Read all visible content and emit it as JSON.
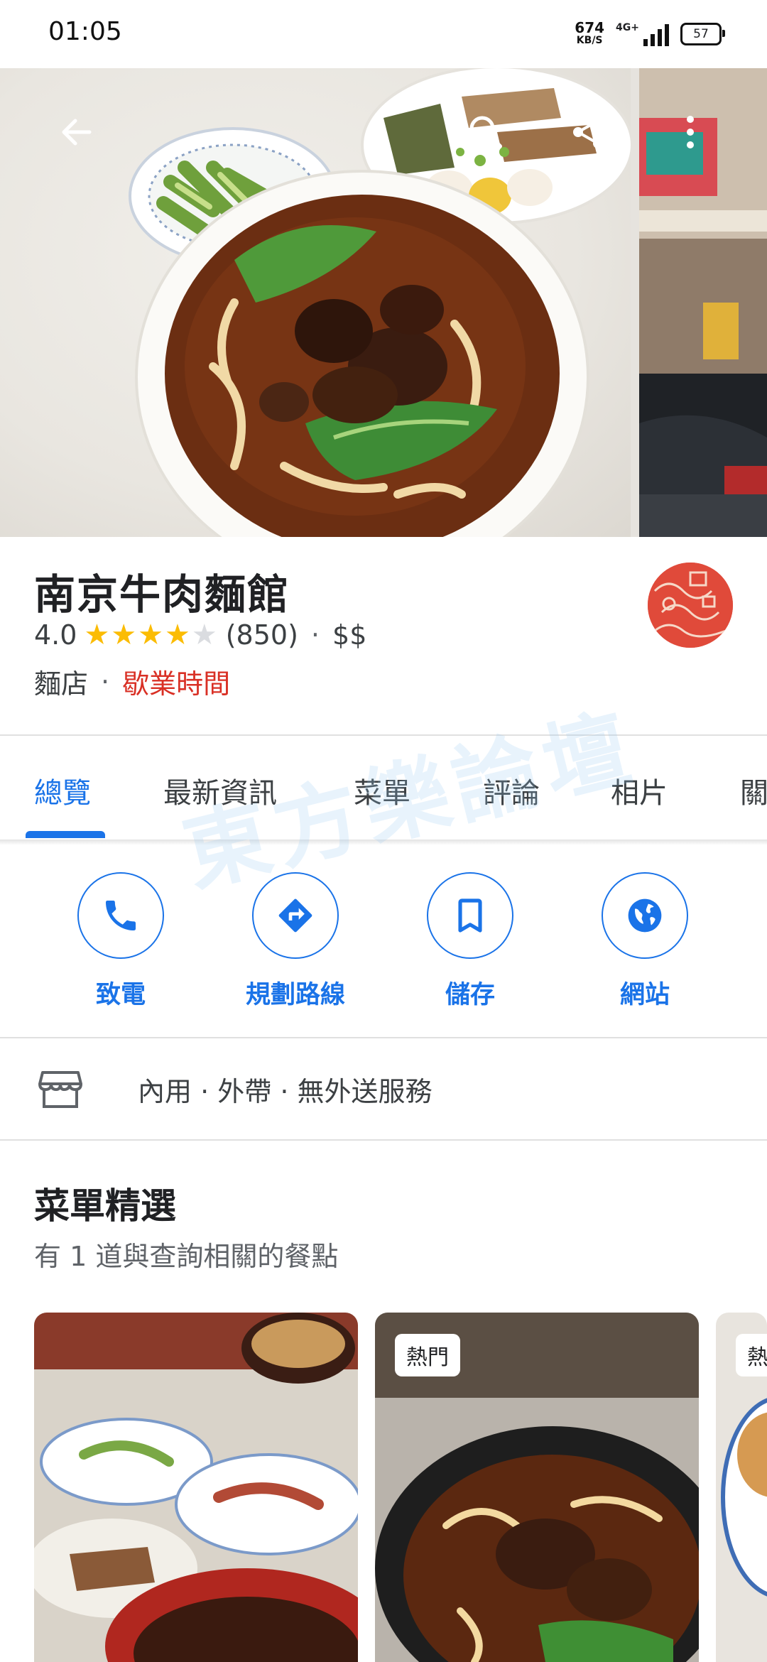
{
  "status_bar": {
    "time": "01:05",
    "net_speed_value": "674",
    "net_speed_unit": "KB/S",
    "network": "4G+",
    "battery": "57"
  },
  "place": {
    "name": "南京牛肉麵館",
    "rating": "4.0",
    "rating_value": 4,
    "review_count": "(850)",
    "separator": "·",
    "price": "$$",
    "category": "麵店",
    "hours_status": "歇業時間"
  },
  "tabs": [
    {
      "label": "總覽",
      "active": true
    },
    {
      "label": "最新資訊"
    },
    {
      "label": "菜單"
    },
    {
      "label": "評論"
    },
    {
      "label": "相片"
    },
    {
      "label": "關"
    }
  ],
  "actions": [
    {
      "label": "致電",
      "icon": "phone-icon"
    },
    {
      "label": "規劃路線",
      "icon": "directions-icon"
    },
    {
      "label": "儲存",
      "icon": "bookmark-icon"
    },
    {
      "label": "網站",
      "icon": "globe-icon"
    }
  ],
  "service_options": "內用 · 外帶 · 無外送服務",
  "menu_highlights": {
    "title": "菜單精選",
    "subtitle": "有 1 道與查詢相關的餐點",
    "badges": [
      "熱門",
      "熱"
    ]
  },
  "watermark": "東方樂論壇",
  "colors": {
    "accent": "#1a73e8",
    "closed": "#d93025",
    "star": "#fbbc04"
  }
}
